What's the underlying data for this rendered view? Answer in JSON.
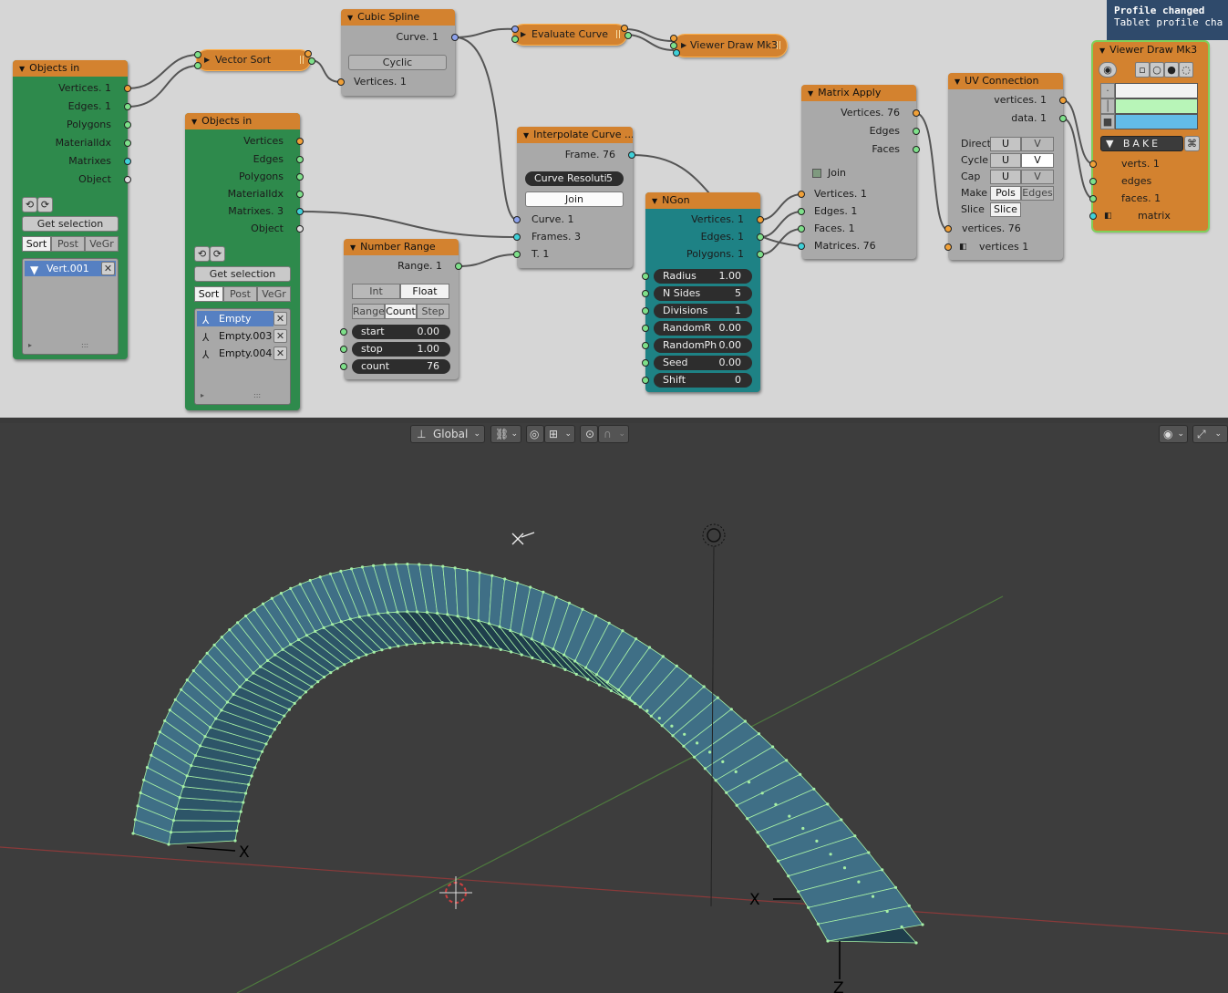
{
  "notification": {
    "title": "Profile changed",
    "message": "Tablet profile cha"
  },
  "nodes": {
    "objects_in_1": {
      "title": "Objects in",
      "outputs": [
        "Vertices. 1",
        "Edges. 1",
        "Polygons",
        "MaterialIdx",
        "Matrixes",
        "Object"
      ],
      "get_selection": "Get selection",
      "tabs": [
        "Sort",
        "Post",
        "VeGr"
      ],
      "items": [
        "Vert.001"
      ]
    },
    "objects_in_2": {
      "title": "Objects in",
      "outputs": [
        "Vertices",
        "Edges",
        "Polygons",
        "MaterialIdx",
        "Matrixes. 3",
        "Object"
      ],
      "get_selection": "Get selection",
      "tabs": [
        "Sort",
        "Post",
        "VeGr"
      ],
      "items": [
        "Empty",
        "Empty.003",
        "Empty.004"
      ]
    },
    "vector_sort": {
      "title": "Vector Sort"
    },
    "cubic_spline": {
      "title": "Cubic Spline",
      "curve_out": "Curve. 1",
      "cyclic": "Cyclic",
      "vertices_in": "Vertices. 1"
    },
    "evaluate_curve": {
      "title": "Evaluate Curve"
    },
    "viewer_draw_1": {
      "title": "Viewer Draw Mk3"
    },
    "interpolate_curve": {
      "title": "Interpolate Curve ...",
      "frame_out": "Frame. 76",
      "resolution": "Curve Resoluti",
      "resolution_value": "5",
      "join": "Join",
      "inputs": [
        "Curve. 1",
        "Frames. 3",
        "T. 1"
      ]
    },
    "number_range": {
      "title": "Number Range",
      "range_out": "Range. 1",
      "modes": [
        "Int",
        "Float"
      ],
      "kinds": [
        "Range",
        "Count",
        "Step"
      ],
      "fields": [
        {
          "label": "start",
          "value": "0.00"
        },
        {
          "label": "stop",
          "value": "1.00"
        },
        {
          "label": "count",
          "value": "76"
        }
      ]
    },
    "ngon": {
      "title": "NGon",
      "outputs": [
        "Vertices. 1",
        "Edges. 1",
        "Polygons. 1"
      ],
      "fields": [
        {
          "label": "Radius",
          "value": "1.00"
        },
        {
          "label": "N Sides",
          "value": "5"
        },
        {
          "label": "Divisions",
          "value": "1"
        },
        {
          "label": "RandomR",
          "value": "0.00"
        },
        {
          "label": "RandomPh",
          "value": "0.00"
        },
        {
          "label": "Seed",
          "value": "0.00"
        },
        {
          "label": "Shift",
          "value": "0"
        }
      ]
    },
    "matrix_apply": {
      "title": "Matrix Apply",
      "outputs": [
        "Vertices. 76",
        "Edges",
        "Faces"
      ],
      "join": "Join",
      "inputs": [
        "Vertices. 1",
        "Edges. 1",
        "Faces. 1",
        "Matrices. 76"
      ]
    },
    "uv_connection": {
      "title": "UV Connection",
      "outputs": [
        "vertices. 1",
        "data. 1"
      ],
      "params": [
        {
          "label": "Directi",
          "a": "U",
          "b": "V"
        },
        {
          "label": "Cycle",
          "a": "U",
          "b": "V"
        },
        {
          "label": "Cap",
          "a": "U",
          "b": "V"
        },
        {
          "label": "Make",
          "a": "Pols",
          "b": "Edges"
        },
        {
          "label": "Slice",
          "a": "Slice",
          "b": ""
        }
      ],
      "inputs": [
        "vertices. 76",
        "vertices 1"
      ]
    },
    "viewer_draw_2": {
      "title": "Viewer Draw Mk3",
      "bake": "BAKE",
      "inputs": [
        "verts. 1",
        "edges",
        "faces. 1",
        "matrix"
      ],
      "colors": [
        "#f2f2f2",
        "#b8f5b8",
        "#63bce8"
      ]
    }
  },
  "viewport": {
    "orientation": "Global",
    "axis_labels": [
      "X",
      "X",
      "Z"
    ],
    "colors": {
      "mesh_face": "#3f6f86",
      "mesh_wire": "#a6f0a6",
      "grid_x": "#8a3a3a",
      "grid_y": "#4e7a3e",
      "background": "#3d3d3d"
    }
  }
}
